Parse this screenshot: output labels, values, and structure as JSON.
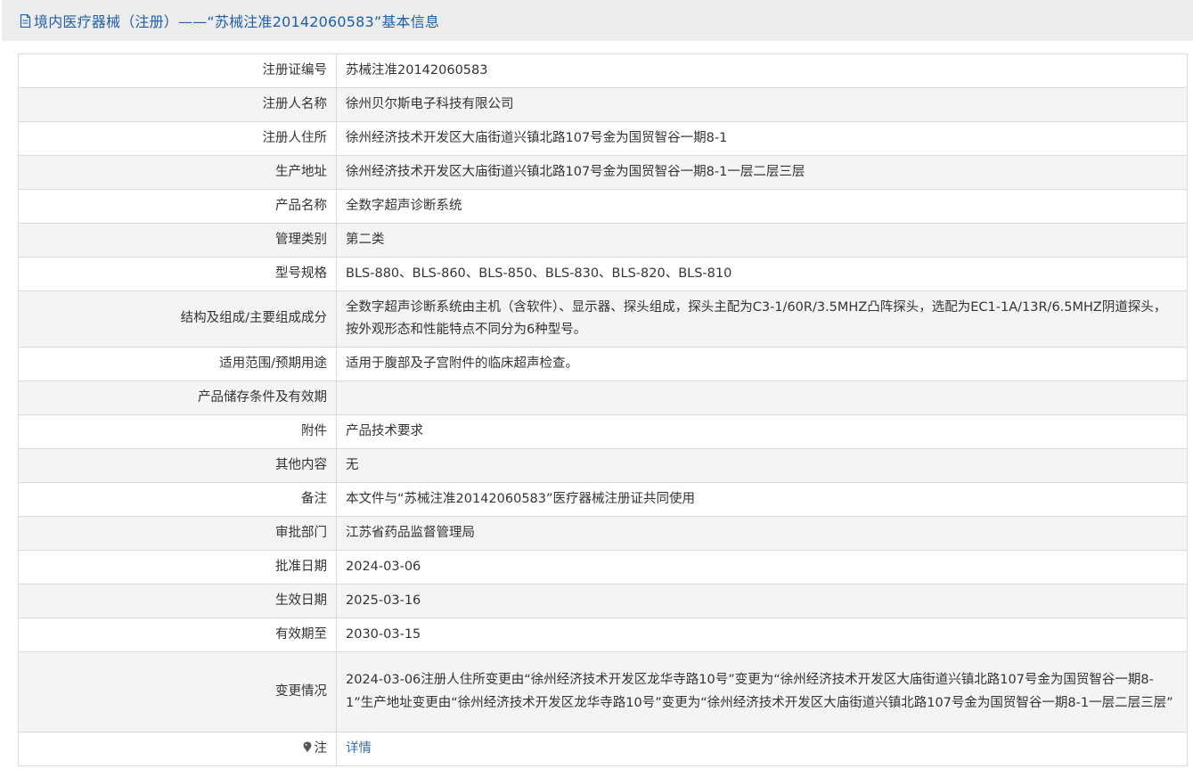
{
  "header": {
    "title": "境内医疗器械（注册）——“苏械注准20142060583”基本信息",
    "icon": "document-icon"
  },
  "rows": [
    {
      "label": "注册证编号",
      "value": "苏械注准20142060583"
    },
    {
      "label": "注册人名称",
      "value": "徐州贝尔斯电子科技有限公司"
    },
    {
      "label": "注册人住所",
      "value": "徐州经济技术开发区大庙街道兴镇北路107号金为国贸智谷一期8-1"
    },
    {
      "label": "生产地址",
      "value": "徐州经济技术开发区大庙街道兴镇北路107号金为国贸智谷一期8-1一层二层三层"
    },
    {
      "label": "产品名称",
      "value": "全数字超声诊断系统"
    },
    {
      "label": "管理类别",
      "value": "第二类"
    },
    {
      "label": "型号规格",
      "value": "BLS-880、BLS-860、BLS-850、BLS-830、BLS-820、BLS-810"
    },
    {
      "label": "结构及组成/主要组成成分",
      "value": "全数字超声诊断系统由主机（含软件）、显示器、探头组成，探头主配为C3-1/60R/3.5MHZ凸阵探头，选配为EC1-1A/13R/6.5MHZ阴道探头，按外观形态和性能特点不同分为6种型号。"
    },
    {
      "label": "适用范围/预期用途",
      "value": "适用于腹部及子宫附件的临床超声检查。"
    },
    {
      "label": "产品储存条件及有效期",
      "value": ""
    },
    {
      "label": "附件",
      "value": "产品技术要求"
    },
    {
      "label": "其他内容",
      "value": "无"
    },
    {
      "label": "备注",
      "value": "本文件与“苏械注准20142060583”医疗器械注册证共同使用"
    },
    {
      "label": "审批部门",
      "value": "江苏省药品监督管理局"
    },
    {
      "label": "批准日期",
      "value": "2024-03-06"
    },
    {
      "label": "生效日期",
      "value": "2025-03-16"
    },
    {
      "label": "有效期至",
      "value": "2030-03-15"
    },
    {
      "label": "变更情况",
      "value": "2024-03-06注册人住所变更由“徐州经济技术开发区龙华寺路10号”变更为“徐州经济技术开发区大庙街道兴镇北路107号金为国贸智谷一期8-1”生产地址变更由“徐州经济技术开发区龙华寺路10号”变更为“徐州经济技术开发区大庙街道兴镇北路107号金为国贸智谷一期8-1一层二层三层”"
    }
  ],
  "note_row": {
    "label": "注",
    "icon": "pin-icon",
    "link_text": "详情"
  }
}
